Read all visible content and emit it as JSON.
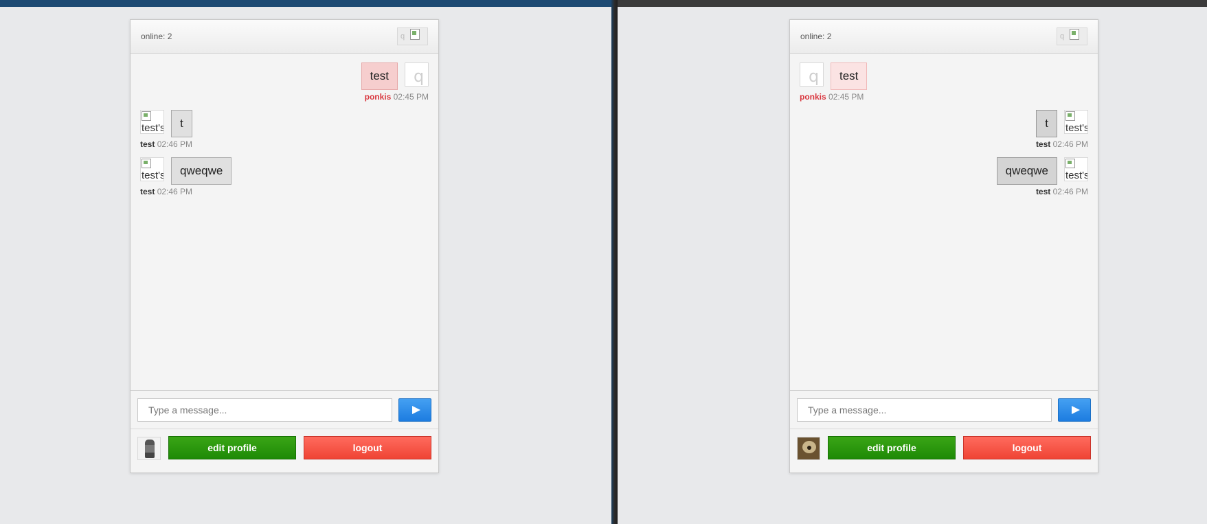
{
  "left_window": {
    "chat": {
      "online_text": "online: 2",
      "header_avatar_letter": "q",
      "messages": [
        {
          "side": "right",
          "text": "test",
          "user": "ponkis",
          "time": "02:45 PM",
          "avatar_glyph": "q"
        },
        {
          "side": "left",
          "text": "t",
          "user": "test",
          "time": "02:46 PM",
          "avatar_alt": "test's"
        },
        {
          "side": "left",
          "text": "qweqwe",
          "user": "test",
          "time": "02:46 PM",
          "avatar_alt": "test's"
        }
      ],
      "input_placeholder": "Type a message...",
      "edit_profile_label": "edit profile",
      "logout_label": "logout"
    }
  },
  "right_window": {
    "chat": {
      "online_text": "online: 2",
      "header_avatar_letter": "q",
      "messages": [
        {
          "side": "left",
          "text": "test",
          "user": "ponkis",
          "time": "02:45 PM",
          "avatar_glyph": "q"
        },
        {
          "side": "right",
          "text": "t",
          "user": "test",
          "time": "02:46 PM",
          "avatar_alt": "test's"
        },
        {
          "side": "right",
          "text": "qweqwe",
          "user": "test",
          "time": "02:46 PM",
          "avatar_alt": "test's"
        }
      ],
      "input_placeholder": "Type a message...",
      "edit_profile_label": "edit profile",
      "logout_label": "logout"
    }
  },
  "colors": {
    "send_button": "#1d7ce0",
    "edit_profile_button": "#1e8a06",
    "logout_button": "#ef4434",
    "own_username": "#d9363e"
  }
}
